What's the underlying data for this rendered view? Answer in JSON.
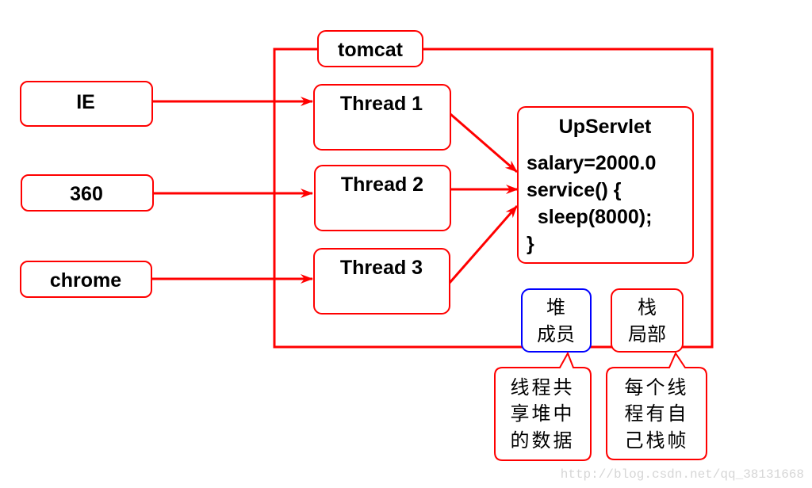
{
  "colors": {
    "stroke": "#ff0000",
    "heap_stroke": "#0000ff",
    "text": "#000000",
    "watermark": "#d6d6d6"
  },
  "container": {
    "label": "tomcat"
  },
  "clients": [
    {
      "label": "IE"
    },
    {
      "label": "360"
    },
    {
      "label": "chrome"
    }
  ],
  "threads": [
    {
      "label": "Thread 1"
    },
    {
      "label": "Thread 2"
    },
    {
      "label": "Thread 3"
    }
  ],
  "servlet": {
    "title": "UpServlet",
    "lines": [
      "salary=2000.0",
      "service() {",
      "  sleep(8000);",
      "}"
    ]
  },
  "heap": {
    "lines": [
      "堆",
      "成员"
    ]
  },
  "stack": {
    "lines": [
      "栈",
      "局部"
    ]
  },
  "heap_callout": {
    "lines": [
      "线程共",
      "享堆中",
      "的数据"
    ]
  },
  "stack_callout": {
    "lines": [
      "每个线",
      "程有自",
      "己栈帧"
    ]
  },
  "watermark": "http://blog.csdn.net/qq_38131668"
}
